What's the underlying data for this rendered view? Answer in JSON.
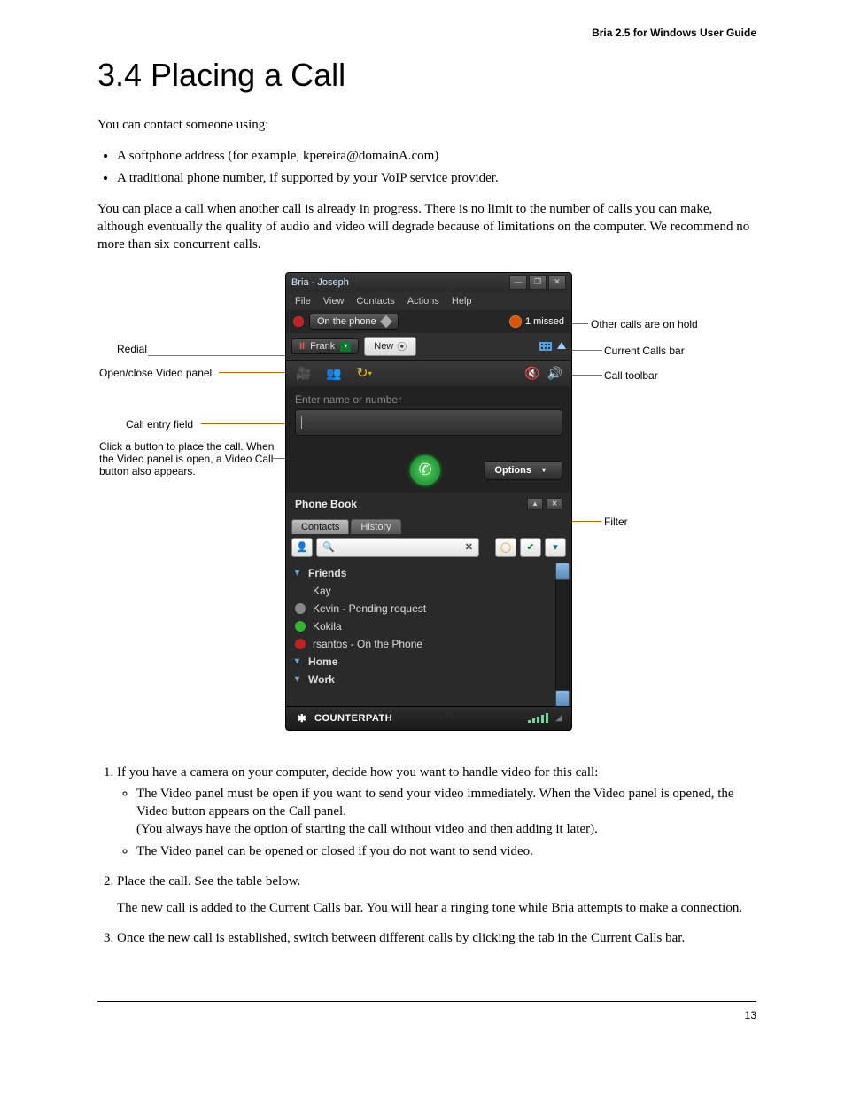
{
  "header": {
    "guide": "Bria 2.5 for Windows User Guide"
  },
  "heading": "3.4 Placing a Call",
  "intro": "You can contact someone using:",
  "intro_bullets": [
    "A softphone address (for example, kpereira@domainA.com)",
    "A traditional phone number, if supported by your VoIP service provider."
  ],
  "intro_para2": "You can place a call when another call is already in progress. There is no limit to the number of calls you can make, although eventually the quality of audio and video will degrade because of limitations on the computer. We recommend no more than six concurrent calls.",
  "callouts": {
    "redial": "Redial",
    "openclose": "Open/close Video panel",
    "entry": "Call entry field",
    "clickbtn": "Click a button to place the call. When the Video panel is open, a Video Call button also appears.",
    "otherhold": "Other calls are on hold",
    "callsbar": "Current Calls bar",
    "toolbar": "Call toolbar",
    "filter": "Filter"
  },
  "bria": {
    "title": "Bria - Joseph",
    "menus": [
      "File",
      "View",
      "Contacts",
      "Actions",
      "Help"
    ],
    "status": "On the phone",
    "missed": "1 missed",
    "tab_frank": "Frank",
    "tab_new": "New",
    "entry_placeholder": "Enter name or number",
    "options": "Options",
    "phone_book": "Phone Book",
    "tab_contacts": "Contacts",
    "tab_history": "History",
    "contacts": {
      "group_friends": "Friends",
      "kay": "Kay",
      "kevin": "Kevin - Pending request",
      "kokila": "Kokila",
      "rsantos": "rsantos - On the Phone",
      "group_home": "Home",
      "group_work": "Work"
    },
    "brand": "COUNTERPATH"
  },
  "steps": {
    "s1": "If you have a camera on your computer, decide how you want to handle video for this call:",
    "s1b1a": "The Video panel must be open if you want to send your video immediately. When the Video panel is opened, the Video button appears on the Call panel.",
    "s1b1b": "(You always have the option of starting the call without video and then adding it later).",
    "s1b2": "The Video panel can be opened or closed if you do not want to send video.",
    "s2a": "Place the call. See the table below.",
    "s2b": "The new call is added to the Current Calls bar. You will hear a ringing tone while Bria attempts to make a connection.",
    "s3": "Once the new call is established, switch between different calls by clicking the tab in the Current Calls bar."
  },
  "page_number": "13"
}
